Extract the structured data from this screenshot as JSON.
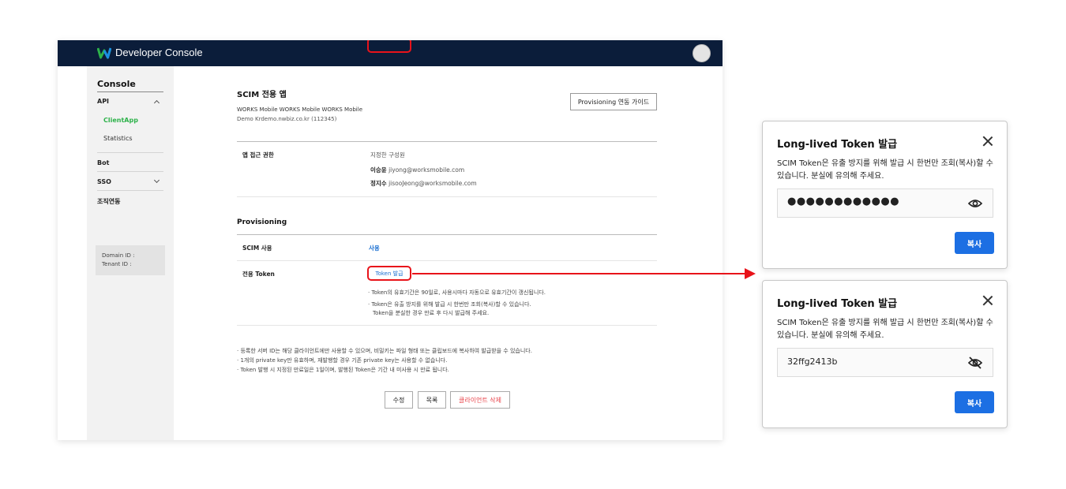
{
  "header": {
    "brand": "Developer Console"
  },
  "sidebar": {
    "title": "Console",
    "items": [
      {
        "label": "API"
      },
      {
        "label": "ClientApp"
      },
      {
        "label": "Statistics"
      },
      {
        "label": "Bot"
      },
      {
        "label": "SSO"
      },
      {
        "label": "조직연동"
      }
    ],
    "domain_label": "Domain ID :",
    "tenant_label": "Tenant ID :"
  },
  "app": {
    "title": "SCIM 전용 앱",
    "subtitle": "WORKS Mobile WORKS Mobile WORKS Mobile",
    "domain": "Demo Krdemo.nwbiz.co.kr (112345)",
    "guide_button": "Provisioning 연동 가이드"
  },
  "access": {
    "label": "앱 접근 권한",
    "scope": "지정한 구성원",
    "members": [
      {
        "name": "이승윤",
        "email": "jiyong@worksmobile.com"
      },
      {
        "name": "정지수",
        "email": "jisooJeong@worksmobile.com"
      }
    ]
  },
  "provisioning": {
    "section_title": "Provisioning",
    "scim_label": "SCIM 사용",
    "scim_value": "사용",
    "token_label": "전용 Token",
    "token_button": "Token 발급",
    "notes": [
      "· Token의 유효기간은 90일로, 사용시마다 자동으로 유효기간이 갱신됩니다.",
      "· Token은 유출 방지를 위해 발급 시 한번만 조회(복사)할 수 있습니다.",
      "Token을 분실한 경우 만료 후 다시 발급해 주세요."
    ]
  },
  "footer_notes": [
    "· 등록한 서버 ID는 해당 클라이언트에만 사용할 수 있으며, 비밀키는 파일 형태 또는 클립보드에 복사하여 발급받을 수 있습니다.",
    "· 1개의 private key만 유효하며, 재발행할 경우 기존 private key는 사용할 수 없습니다.",
    "· Token 발행 시 지정된 만료일은 1일이며, 발행된 Token은 기간 내 미사용 시 만료 됩니다."
  ],
  "actions": {
    "edit": "수정",
    "list": "목록",
    "delete": "클라이언트 삭제"
  },
  "modal_hidden": {
    "title": "Long-lived Token 발급",
    "desc": "SCIM Token은 유출 방지를 위해 발급 시 한번만 조회(복사)할 수 있습니다. 분실에 유의해 주세요.",
    "value": "●●●●●●●●●●●●",
    "copy": "복사"
  },
  "modal_shown": {
    "title": "Long-lived Token 발급",
    "desc": "SCIM Token은 유출 방지를 위해 발급 시 한번만 조회(복사)할 수 있습니다. 분실에 유의해 주세요.",
    "value": "32ffg2413b",
    "copy": "복사"
  },
  "colors": {
    "topbar": "#0b1d3a",
    "accent": "#1c6fe3",
    "active": "#2db24a",
    "highlight": "#e8131a",
    "danger": "#e8444b"
  }
}
